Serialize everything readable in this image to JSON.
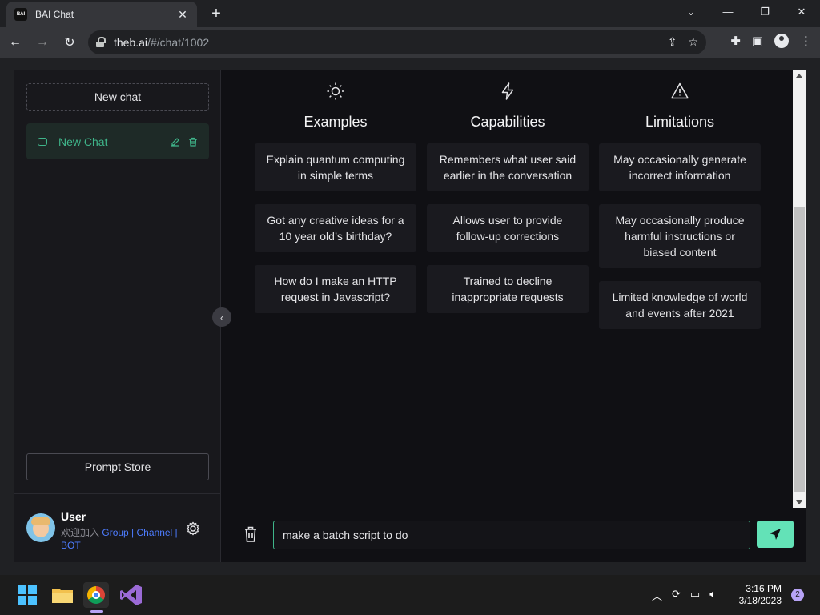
{
  "browser": {
    "tab_title": "BAI Chat",
    "tab_favicon_text": "BAI",
    "url_host": "theb.ai",
    "url_path": "/#/chat/1002"
  },
  "sidebar": {
    "new_chat_label": "New chat",
    "chats": [
      {
        "title": "New Chat"
      }
    ],
    "prompt_store_label": "Prompt Store",
    "user": {
      "name": "User",
      "welcome": "欢迎加入",
      "link_group": "Group",
      "sep1": " | ",
      "link_channel": "Channel",
      "sep2": " |",
      "link_bot": "BOT"
    }
  },
  "main": {
    "columns": [
      {
        "icon": "sun-icon",
        "title": "Examples",
        "cards": [
          "Explain quantum computing in simple terms",
          "Got any creative ideas for a 10 year old’s birthday?",
          "How do I make an HTTP request in Javascript?"
        ]
      },
      {
        "icon": "lightning-icon",
        "title": "Capabilities",
        "cards": [
          "Remembers what user said earlier in the conversation",
          "Allows user to provide follow-up corrections",
          "Trained to decline inappropriate requests"
        ]
      },
      {
        "icon": "warning-icon",
        "title": "Limitations",
        "cards": [
          "May occasionally generate incorrect information",
          "May occasionally produce harmful instructions or biased content",
          "Limited knowledge of world and events after 2021"
        ]
      }
    ],
    "input_value": "make a batch script to do"
  },
  "taskbar": {
    "time": "3:16 PM",
    "date": "3/18/2023",
    "notification_count": "2"
  },
  "colors": {
    "accent": "#63e2b7",
    "accent_text": "#3fb58a",
    "link": "#4d7cff"
  }
}
